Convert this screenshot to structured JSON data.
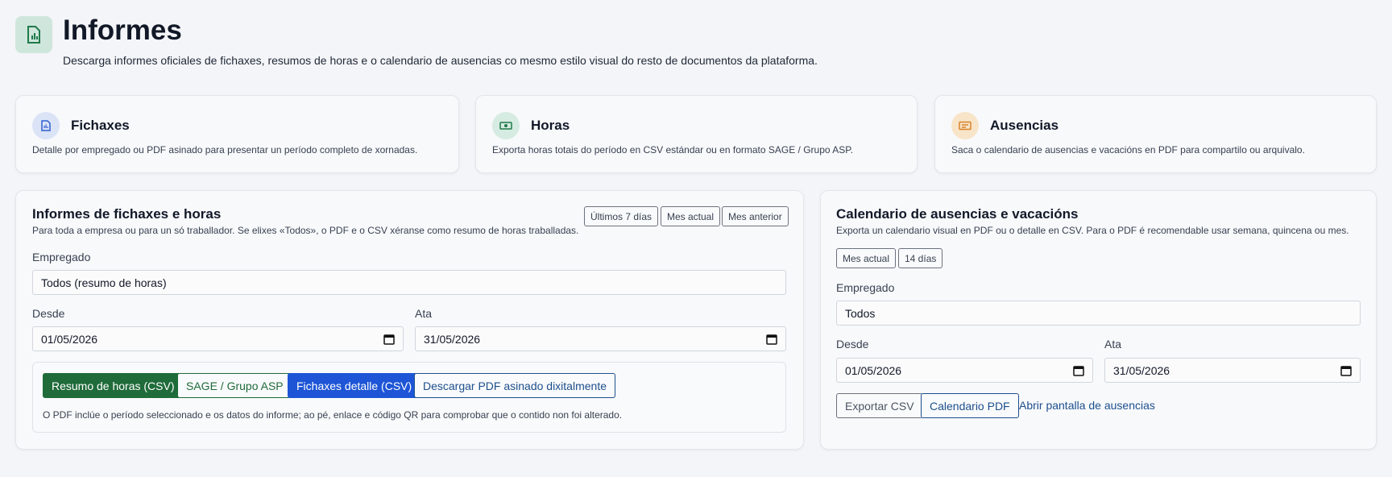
{
  "header": {
    "title": "Informes",
    "subtitle": "Descarga informes oficiales de fichaxes, resumos de horas e o calendario de ausencias co mesmo estilo visual do resto de documentos da plataforma.",
    "icon": "report-chart-icon"
  },
  "cards": [
    {
      "title": "Fichaxes",
      "description": "Detalle por empregado ou PDF asinado para presentar un período completo de xornadas.",
      "icon": "document-icon",
      "color": "#dbe3f7"
    },
    {
      "title": "Horas",
      "description": "Exporta horas totais do período en CSV estándar ou en formato SAGE / Grupo ASP.",
      "icon": "cash-icon",
      "color": "#d6ebe1"
    },
    {
      "title": "Ausencias",
      "description": "Saca o calendario de ausencias e vacacións en PDF para compartilo ou arquivalo.",
      "icon": "id-card-icon",
      "color": "#f8e4c8"
    }
  ],
  "hours_panel": {
    "title": "Informes de fichaxes e horas",
    "description": "Para toda a empresa ou para un só traballador. Se elixes «Todos», o PDF e o CSV xéranse como resumo de horas traballadas.",
    "chips": [
      "Últimos 7 días",
      "Mes actual",
      "Mes anterior"
    ],
    "employee_label": "Empregado",
    "employee_value": "Todos (resumo de horas)",
    "from_label": "Desde",
    "from_value": "01/05/2026",
    "to_label": "Ata",
    "to_value": "31/05/2026",
    "buttons": {
      "summary_csv": "Resumo de horas (CSV)",
      "sage": "SAGE / Grupo ASP",
      "detail_csv": "Fichaxes detalle (CSV)",
      "signed_pdf": "Descargar PDF asinado dixitalmente"
    },
    "note": "O PDF inclúe o período seleccionado e os datos do informe; ao pé, enlace e código QR para comprobar que o contido non foi alterado."
  },
  "absence_panel": {
    "title": "Calendario de ausencias e vacacións",
    "description": "Exporta un calendario visual en PDF ou o detalle en CSV. Para o PDF é recomendable usar semana, quincena ou mes.",
    "chips": [
      "Mes actual",
      "14 días"
    ],
    "employee_label": "Empregado",
    "employee_value": "Todos",
    "from_label": "Desde",
    "from_value": "01/05/2026",
    "to_label": "Ata",
    "to_value": "31/05/2026",
    "buttons": {
      "export_csv": "Exportar CSV",
      "calendar_pdf": "Calendario PDF",
      "open_screen": "Abrir pantalla de ausencias"
    }
  },
  "colors": {
    "primary_green": "#1f6b3a",
    "primary_blue": "#1d55d6",
    "link_blue": "#1d4f8e"
  }
}
